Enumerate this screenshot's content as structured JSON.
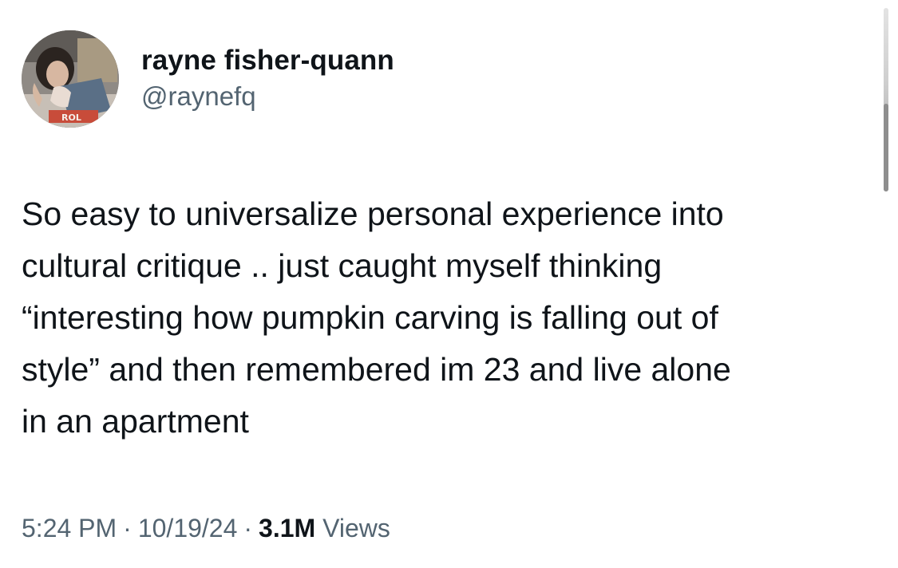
{
  "tweet": {
    "author": {
      "display_name": "rayne fisher-quann",
      "handle": "@raynefq",
      "avatar_icon": "profile-photo-avatar"
    },
    "text": "So easy to universalize personal experience into\ncultural critique .. just caught myself thinking\n“interesting how pumpkin carving is falling out of\nstyle” and then remembered im 23 and live alone\nin an apartment",
    "time": "5:24 PM",
    "separator": "·",
    "date": "10/19/24",
    "views_count": "3.1M",
    "views_label": "Views"
  },
  "colors": {
    "text_primary": "#0f1419",
    "text_secondary": "#536471",
    "background": "#ffffff"
  }
}
